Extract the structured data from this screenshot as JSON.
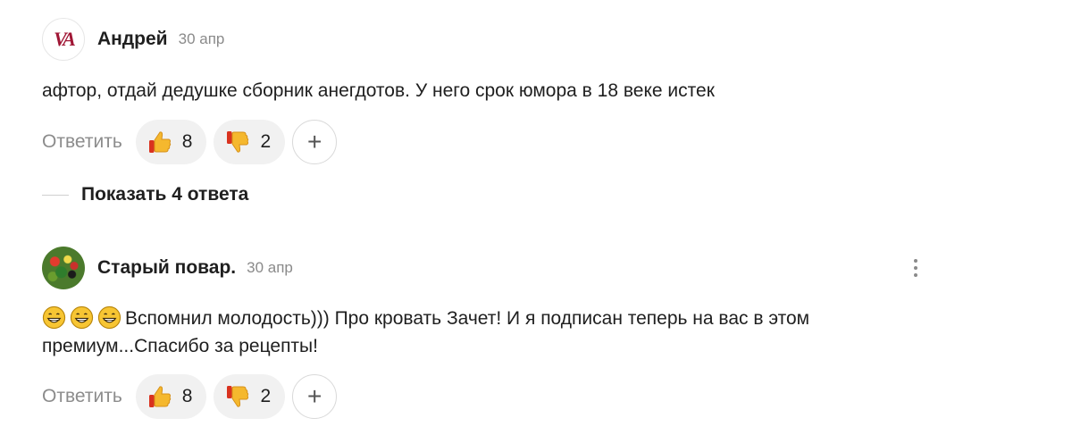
{
  "comments": [
    {
      "author": "Андрей",
      "date": "30 апр",
      "avatar_text": "VA",
      "text": "афтор, отдай дедушке сборник анегдотов. У него срок юмора в 18 веке истек",
      "reply_label": "Ответить",
      "likes": "8",
      "dislikes": "2",
      "add_label": "+"
    },
    {
      "author": "Старый повар.",
      "date": "30 апр",
      "text": "Вспомнил молодость))) Про кровать Зачет! И я подписан теперь на вас в этом премиум...Спасибо за рецепты!",
      "emoji_prefix_count": 3,
      "reply_label": "Ответить",
      "likes": "8",
      "dislikes": "2",
      "add_label": "+"
    }
  ],
  "show_replies_label": "Показать 4 ответа",
  "colors": {
    "accent_logo": "#a01635",
    "muted_text": "#8a8a8a",
    "reaction_bg": "#f1f1f1",
    "thumb_yellow": "#f5b82e",
    "thumb_red": "#d9321f"
  },
  "icons": [
    "thumbs-up-icon",
    "thumbs-down-icon",
    "plus-icon",
    "more-vertical-icon",
    "grinning-face-icon"
  ]
}
